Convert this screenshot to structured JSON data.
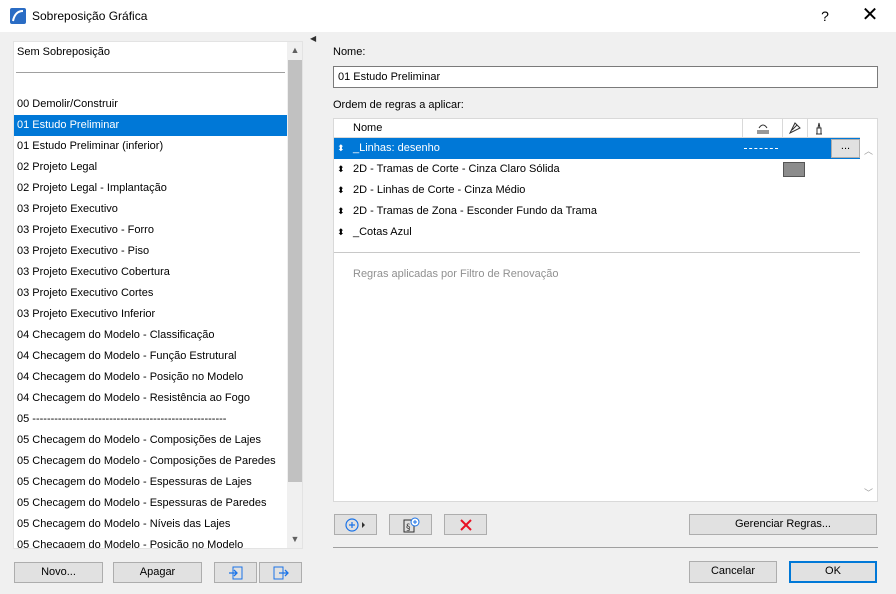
{
  "window": {
    "title": "Sobreposição Gráfica",
    "help_label": "?",
    "close_label": "✕"
  },
  "left": {
    "top_item": "Sem Sobreposição",
    "items": [
      "00 Demolir/Construir",
      "01 Estudo Preliminar",
      "01 Estudo Preliminar (inferior)",
      "02 Projeto Legal",
      "02 Projeto Legal - Implantação",
      "03 Projeto Executivo",
      "03 Projeto Executivo - Forro",
      "03 Projeto Executivo - Piso",
      "03 Projeto Executivo Cobertura",
      "03 Projeto Executivo Cortes",
      "03 Projeto Executivo Inferior",
      "04 Checagem do Modelo - Classificação",
      "04 Checagem do Modelo - Função Estrutural",
      "04 Checagem do Modelo - Posição no Modelo",
      "04 Checagem do Modelo - Resistência ao Fogo",
      "05 -----------------------------------------------------",
      "05 Checagem do Modelo - Composições de Lajes",
      "05 Checagem do Modelo - Composições de Paredes",
      "05 Checagem do Modelo - Espessuras de Lajes",
      "05 Checagem do Modelo - Espessuras de Paredes",
      "05 Checagem do Modelo - Níveis das Lajes",
      "05 Checagem do Modelo - Posição no Modelo"
    ],
    "selected_index": 1,
    "buttons": {
      "new": "Novo...",
      "delete": "Apagar"
    }
  },
  "right": {
    "name_label": "Nome:",
    "name_value": "01 Estudo Preliminar",
    "rules_label": "Ordem de regras a aplicar:",
    "column_name": "Nome",
    "rules": [
      "_Linhas: desenho",
      "2D - Tramas de Corte - Cinza Claro Sólida",
      "2D - Linhas de Corte - Cinza Médio",
      "2D - Tramas de Zona - Esconder Fundo da Trama",
      "_Cotas Azul"
    ],
    "selected_rule": 0,
    "more_label": "...",
    "renovation_text": "Regras aplicadas por Filtro de Renovação",
    "manage_rules": "Gerenciar Regras...",
    "cancel": "Cancelar",
    "ok": "OK"
  },
  "colors": {
    "accent": "#0078d7",
    "delete_red": "#e81123",
    "add_blue": "#1a73e8"
  }
}
